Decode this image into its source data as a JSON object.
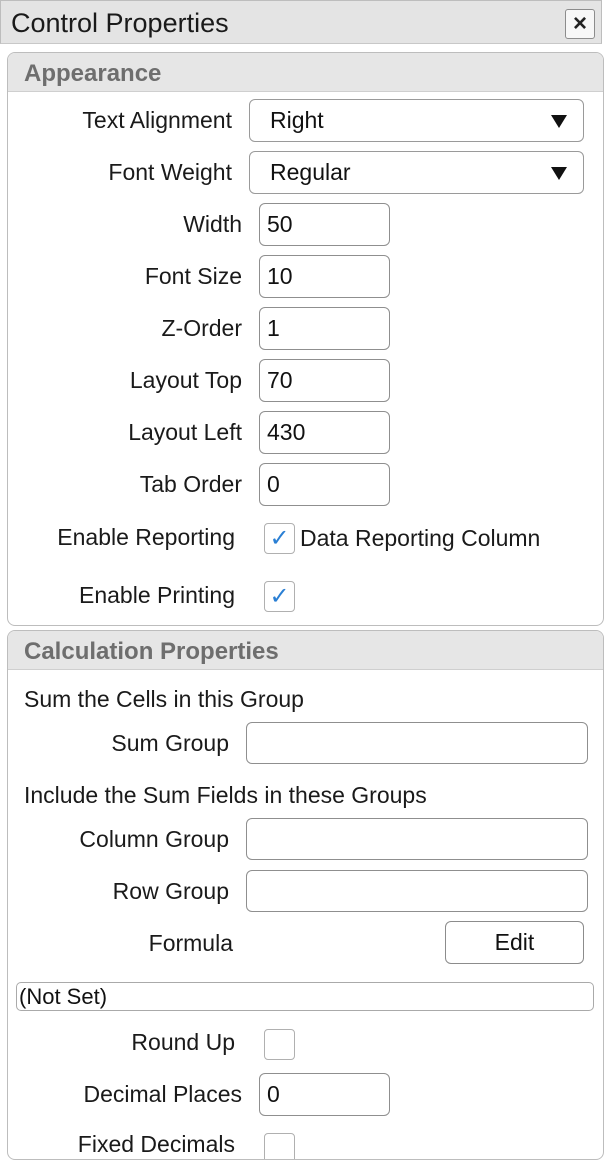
{
  "window": {
    "title": "Control Properties"
  },
  "appearance": {
    "title": "Appearance",
    "text_alignment": {
      "label": "Text Alignment",
      "value": "Right"
    },
    "font_weight": {
      "label": "Font Weight",
      "value": "Regular"
    },
    "width": {
      "label": "Width",
      "value": "50"
    },
    "font_size": {
      "label": "Font Size",
      "value": "10"
    },
    "z_order": {
      "label": "Z-Order",
      "value": "1"
    },
    "layout_top": {
      "label": "Layout Top",
      "value": "70"
    },
    "layout_left": {
      "label": "Layout Left",
      "value": "430"
    },
    "tab_order": {
      "label": "Tab Order",
      "value": "0"
    },
    "enable_reporting": {
      "label": "Enable Reporting",
      "checked": true,
      "checkbox_label": "Data Reporting Column"
    },
    "enable_printing": {
      "label": "Enable Printing",
      "checked": true
    }
  },
  "calculation": {
    "title": "Calculation Properties",
    "sum_cells_heading": "Sum the Cells in this Group",
    "sum_group": {
      "label": "Sum Group",
      "value": ""
    },
    "include_heading": "Include the Sum Fields in these Groups",
    "column_group": {
      "label": "Column Group",
      "value": ""
    },
    "row_group": {
      "label": "Row Group",
      "value": ""
    },
    "formula": {
      "label": "Formula",
      "button": "Edit",
      "value": "(Not Set)"
    },
    "round_up": {
      "label": "Round Up",
      "checked": false
    },
    "decimal_places": {
      "label": "Decimal Places",
      "value": "0"
    },
    "fixed_decimals": {
      "label": "Fixed Decimals",
      "checked": false
    }
  },
  "glyphs": {
    "close": "×",
    "check": "✓"
  },
  "colors": {
    "check": "#2a7fd4",
    "header_bg": "#e6e6e6",
    "section_title": "#6e6e6e"
  }
}
